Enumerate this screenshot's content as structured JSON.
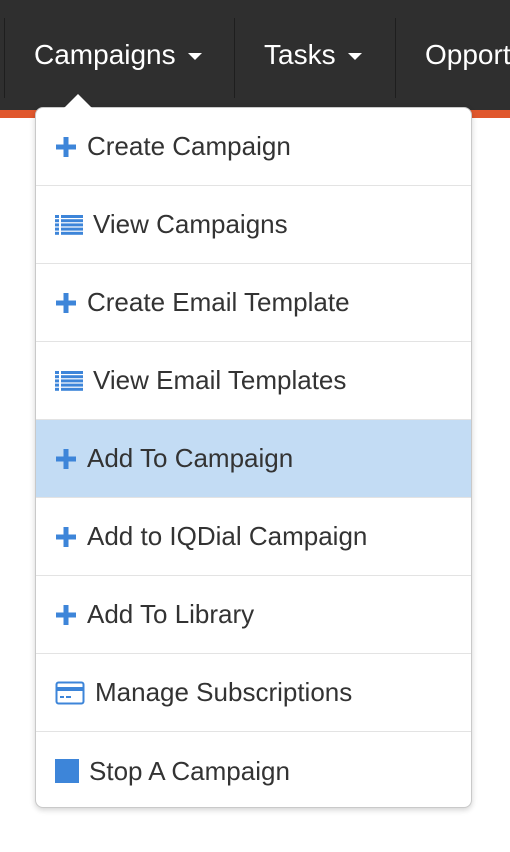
{
  "nav": {
    "items": [
      {
        "label": "Campaigns",
        "has_caret": true
      },
      {
        "label": "Tasks",
        "has_caret": true
      },
      {
        "label": "Opport",
        "has_caret": false
      }
    ],
    "colors": {
      "bar": "#2f2f2f",
      "accent": "#e0572d",
      "text": "#ffffff"
    }
  },
  "dropdown": {
    "icon_color": "#3d85d9",
    "active_bg": "#c3dcf4",
    "items": [
      {
        "label": "Create Campaign",
        "icon": "plus-icon"
      },
      {
        "label": "View Campaigns",
        "icon": "list-icon"
      },
      {
        "label": "Create Email Template",
        "icon": "plus-icon"
      },
      {
        "label": "View Email Templates",
        "icon": "list-icon"
      },
      {
        "label": "Add To Campaign",
        "icon": "plus-icon",
        "active": true
      },
      {
        "label": "Add to IQDial Campaign",
        "icon": "plus-icon"
      },
      {
        "label": "Add To Library",
        "icon": "plus-icon"
      },
      {
        "label": "Manage Subscriptions",
        "icon": "credit-card-icon"
      },
      {
        "label": "Stop A Campaign",
        "icon": "stop-icon"
      }
    ]
  }
}
